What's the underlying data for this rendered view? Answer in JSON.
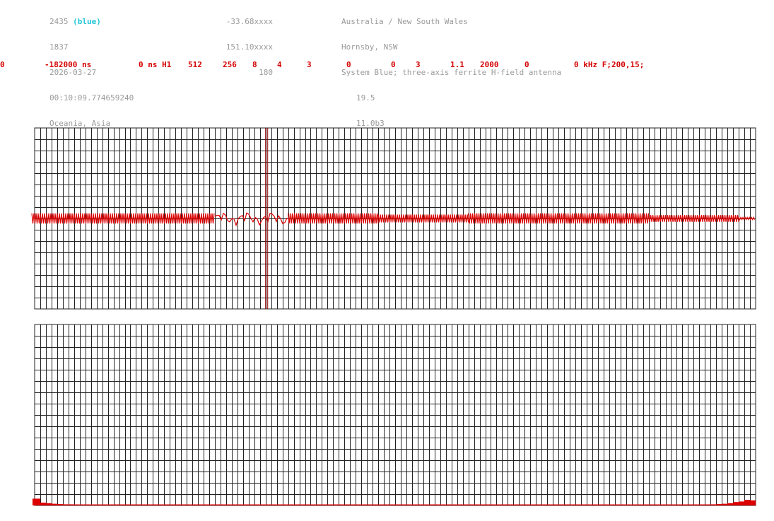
{
  "header": {
    "col1": [
      "2435",
      "1837",
      "2026-03-27",
      "00:10:09.774659240",
      "Oceania, Asia"
    ],
    "col1_tag": "(blue)",
    "col2": [
      "-33.68xxxx",
      "151.10xxxx",
      "180"
    ],
    "col3": [
      "Australia / New South Wales",
      "Hornsby, NSW",
      "System Blue; three-axis ferrite H-field antenna",
      "19.5",
      "11.0b3"
    ]
  },
  "params": [
    "0",
    "-182000 ns",
    "0 ns H1",
    "512",
    "256",
    "8",
    "4",
    "3",
    "0",
    "0",
    "3",
    "1.1",
    "2000",
    "0",
    "0 kHz F;200,15;"
  ],
  "colors": {
    "grid": "#222222",
    "trace": "#dd0000",
    "marker": "#990000",
    "header_text": "#9a9a9a",
    "tag": "#22c6d6"
  },
  "chart_data": [
    {
      "type": "line",
      "description": "time-domain waveform panel",
      "grid": true,
      "x_divisions": 128,
      "y_divisions": 16,
      "ylim": [
        -8,
        8
      ],
      "marker_x": 41,
      "segments": [
        {
          "x": [
            0,
            32
          ],
          "amplitude": 0.45,
          "style": "dense"
        },
        {
          "x": [
            32,
            45
          ],
          "amplitude": 0.5,
          "style": "noisy"
        },
        {
          "x": [
            45,
            61
          ],
          "amplitude": 0.45,
          "style": "dense"
        },
        {
          "x": [
            61,
            77
          ],
          "amplitude": 0.35,
          "style": "dense"
        },
        {
          "x": [
            77,
            109
          ],
          "amplitude": 0.45,
          "style": "dense"
        },
        {
          "x": [
            109,
            125
          ],
          "amplitude": 0.3,
          "style": "dense"
        },
        {
          "x": [
            125,
            128
          ],
          "amplitude": 0.1,
          "style": "dense"
        }
      ]
    },
    {
      "type": "area",
      "description": "spectrum panel",
      "grid": true,
      "x_divisions": 128,
      "y_divisions": 16,
      "ylim": [
        0,
        16
      ],
      "values_start": [
        0.6,
        0.25,
        0.2,
        0.15,
        0.12,
        0.1,
        0.1,
        0.08
      ],
      "baseline": 0.06,
      "values_end": [
        0.1,
        0.12,
        0.15,
        0.2,
        0.3,
        0.35,
        0.5,
        0.45
      ]
    }
  ]
}
